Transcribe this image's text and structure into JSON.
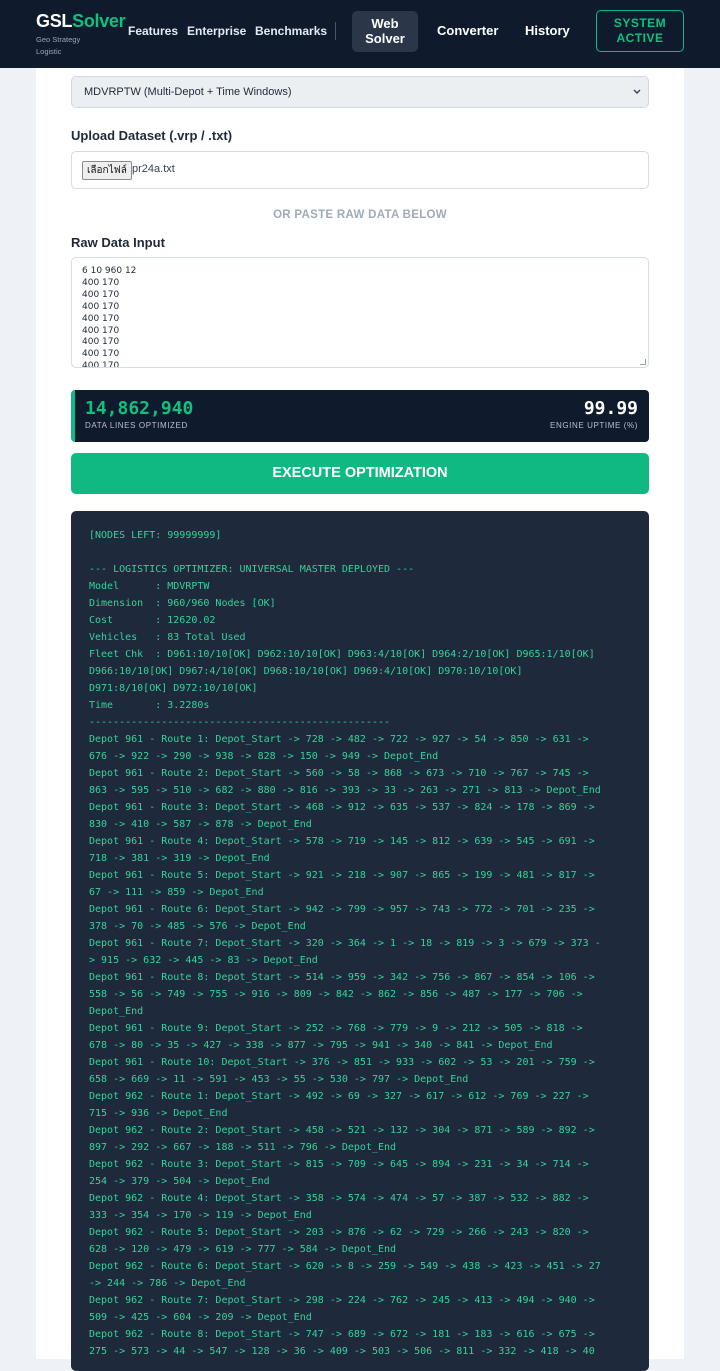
{
  "brand": {
    "name_part1": "GSL",
    "name_part2": "Solver",
    "sub_line1": "Geo Strategy",
    "sub_line2": "Logistic"
  },
  "nav": {
    "features": "Features",
    "enterprise": "Enterprise",
    "benchmarks": "Benchmarks",
    "web_solver_line1": "Web",
    "web_solver_line2": "Solver",
    "converter": "Converter",
    "history": "History",
    "status_line1": "SYSTEM",
    "status_line2": "ACTIVE"
  },
  "form": {
    "model_select": "MDVRPTW (Multi-Depot + Time Windows)",
    "upload_label": "Upload Dataset (.vrp / .txt)",
    "file_button": "เลือกไฟล์",
    "file_name": "pr24a.txt",
    "or_paste": "OR PASTE RAW DATA BELOW",
    "raw_label": "Raw Data Input",
    "raw_lines": [
      "6 10 960 12",
      "400 170",
      "400 170",
      "400 170",
      "400 170",
      "400 170",
      "400 170",
      "400 170",
      "400 170"
    ]
  },
  "stats": {
    "lines_value": "14,862,940",
    "lines_label": "DATA LINES OPTIMIZED",
    "uptime_value": "99.99",
    "uptime_label": "ENGINE UPTIME (%)"
  },
  "execute_label": "EXECUTE OPTIMIZATION",
  "colors": {
    "accent": "#10b981",
    "navy": "#0f1b2d",
    "console_bg": "#1e293b",
    "console_text": "#34d399"
  },
  "console_lines": [
    "[NODES LEFT: 99999999]",
    "",
    "--- LOGISTICS OPTIMIZER: UNIVERSAL MASTER DEPLOYED ---",
    "Model      : MDVRPTW",
    "Dimension  : 960/960 Nodes [OK]",
    "Cost       : 12620.02",
    "Vehicles   : 83 Total Used",
    "Fleet Chk  : D961:10/10[OK] D962:10/10[OK] D963:4/10[OK] D964:2/10[OK] D965:1/10[OK]",
    "D966:10/10[OK] D967:4/10[OK] D968:10/10[OK] D969:4/10[OK] D970:10/10[OK]",
    "D971:8/10[OK] D972:10/10[OK]",
    "Time       : 3.2280s",
    "--------------------------------------------------",
    "Depot 961 - Route 1: Depot_Start -> 728 -> 482 -> 722 -> 927 -> 54 -> 850 -> 631 ->",
    "676 -> 922 -> 290 -> 938 -> 828 -> 150 -> 949 -> Depot_End",
    "Depot 961 - Route 2: Depot_Start -> 560 -> 58 -> 868 -> 673 -> 710 -> 767 -> 745 ->",
    "863 -> 595 -> 510 -> 682 -> 880 -> 816 -> 393 -> 33 -> 263 -> 271 -> 813 -> Depot_End",
    "Depot 961 - Route 3: Depot_Start -> 468 -> 912 -> 635 -> 537 -> 824 -> 178 -> 869 ->",
    "830 -> 410 -> 587 -> 878 -> Depot_End",
    "Depot 961 - Route 4: Depot_Start -> 578 -> 719 -> 145 -> 812 -> 639 -> 545 -> 691 ->",
    "718 -> 381 -> 319 -> Depot_End",
    "Depot 961 - Route 5: Depot_Start -> 921 -> 218 -> 907 -> 865 -> 199 -> 481 -> 817 ->",
    "67 -> 111 -> 859 -> Depot_End",
    "Depot 961 - Route 6: Depot_Start -> 942 -> 799 -> 957 -> 743 -> 772 -> 701 -> 235 ->",
    "378 -> 70 -> 485 -> 576 -> Depot_End",
    "Depot 961 - Route 7: Depot_Start -> 320 -> 364 -> 1 -> 18 -> 819 -> 3 -> 679 -> 373 -",
    "> 915 -> 632 -> 445 -> 83 -> Depot_End",
    "Depot 961 - Route 8: Depot_Start -> 514 -> 959 -> 342 -> 756 -> 867 -> 854 -> 106 ->",
    "558 -> 56 -> 749 -> 755 -> 916 -> 809 -> 842 -> 862 -> 856 -> 487 -> 177 -> 706 ->",
    "Depot_End",
    "Depot 961 - Route 9: Depot_Start -> 252 -> 768 -> 779 -> 9 -> 212 -> 505 -> 818 ->",
    "678 -> 80 -> 35 -> 427 -> 338 -> 877 -> 795 -> 941 -> 340 -> 841 -> Depot_End",
    "Depot 961 - Route 10: Depot_Start -> 376 -> 851 -> 933 -> 602 -> 53 -> 201 -> 759 ->",
    "658 -> 669 -> 11 -> 591 -> 453 -> 55 -> 530 -> 797 -> Depot_End",
    "Depot 962 - Route 1: Depot_Start -> 492 -> 69 -> 327 -> 617 -> 612 -> 769 -> 227 ->",
    "715 -> 936 -> Depot_End",
    "Depot 962 - Route 2: Depot_Start -> 458 -> 521 -> 132 -> 304 -> 871 -> 589 -> 892 ->",
    "897 -> 292 -> 667 -> 188 -> 511 -> 796 -> Depot_End",
    "Depot 962 - Route 3: Depot_Start -> 815 -> 709 -> 645 -> 894 -> 231 -> 34 -> 714 ->",
    "254 -> 379 -> 504 -> Depot_End",
    "Depot 962 - Route 4: Depot_Start -> 358 -> 574 -> 474 -> 57 -> 387 -> 532 -> 882 ->",
    "333 -> 354 -> 170 -> 119 -> Depot_End",
    "Depot 962 - Route 5: Depot_Start -> 203 -> 876 -> 62 -> 729 -> 266 -> 243 -> 820 ->",
    "628 -> 120 -> 479 -> 619 -> 777 -> 584 -> Depot_End",
    "Depot 962 - Route 6: Depot_Start -> 620 -> 8 -> 259 -> 549 -> 438 -> 423 -> 451 -> 27",
    "-> 244 -> 786 -> Depot_End",
    "Depot 962 - Route 7: Depot_Start -> 298 -> 224 -> 762 -> 245 -> 413 -> 494 -> 940 ->",
    "509 -> 425 -> 604 -> 209 -> Depot_End",
    "Depot 962 - Route 8: Depot_Start -> 747 -> 689 -> 672 -> 181 -> 183 -> 616 -> 675 ->",
    "275 -> 573 -> 44 -> 547 -> 128 -> 36 -> 409 -> 503 -> 506 -> 811 -> 332 -> 418 -> 40"
  ]
}
